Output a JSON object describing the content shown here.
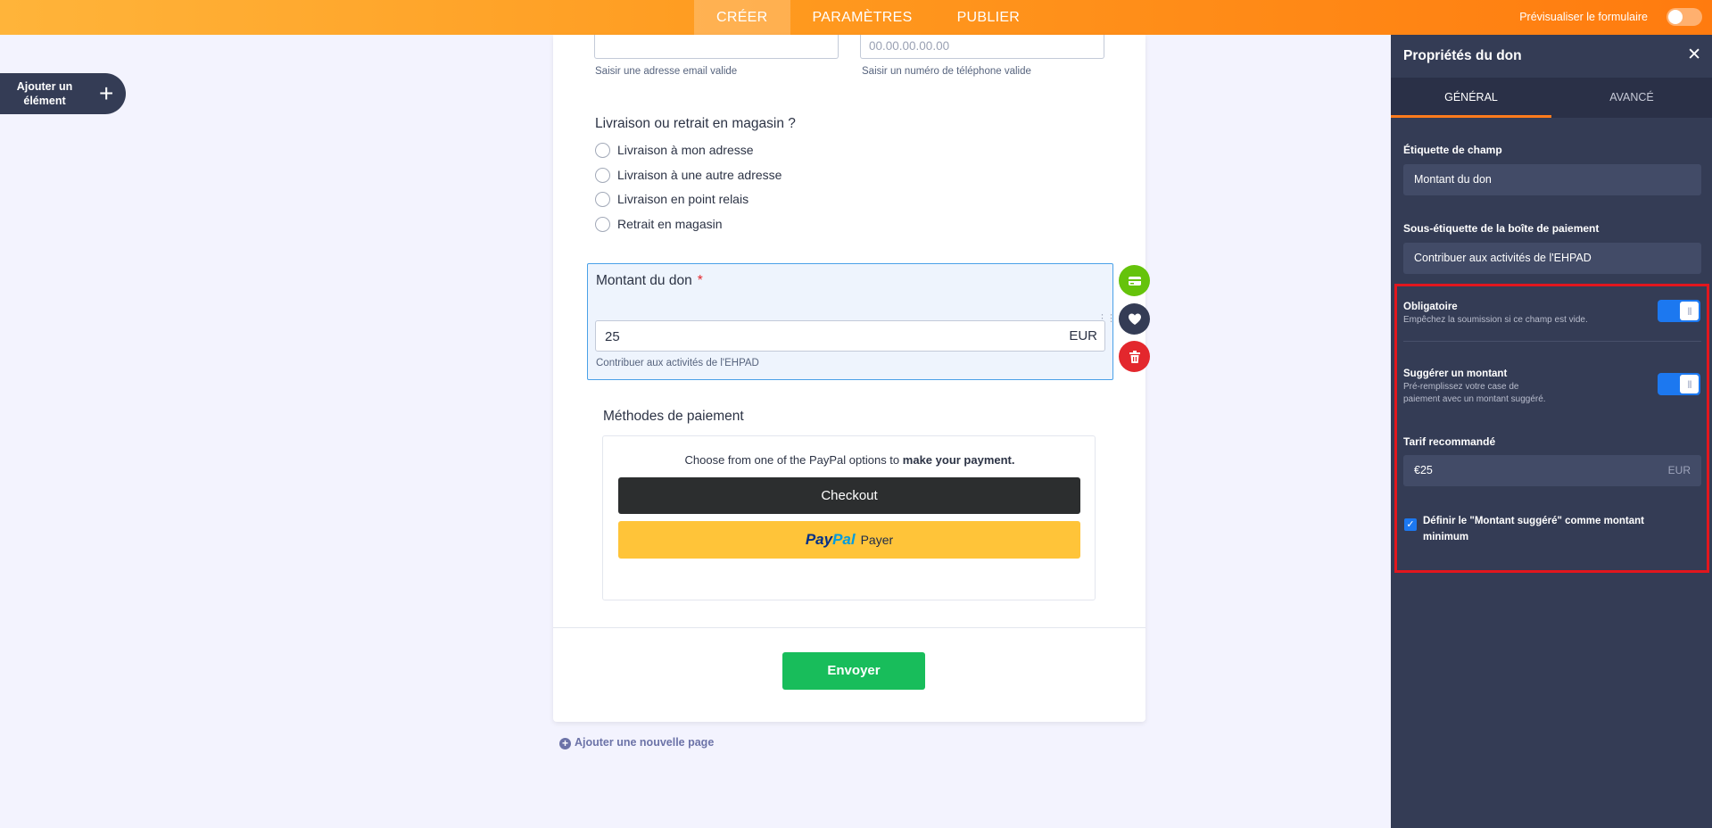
{
  "topbar": {
    "tabs": [
      "CRÉER",
      "PARAMÈTRES",
      "PUBLIER"
    ],
    "active_tab": "CRÉER",
    "preview_label": "Prévisualiser le formulaire",
    "preview_enabled": false
  },
  "sidebar": {
    "add_element_label": "Ajouter un élément",
    "add_icon": "plus-icon"
  },
  "form": {
    "email_sublabel": "Saisir une adresse email valide",
    "phone_placeholder": "00.00.00.00.00",
    "phone_sublabel": "Saisir un numéro de téléphone valide",
    "delivery_question": "Livraison ou retrait en magasin ?",
    "delivery_options": [
      "Livraison à mon adresse",
      "Livraison à une autre adresse",
      "Livraison en point relais",
      "Retrait en magasin"
    ],
    "donation": {
      "label": "Montant du don",
      "required_mark": "*",
      "value": "25",
      "currency": "EUR",
      "sublabel": "Contribuer aux activités de l'EHPAD"
    },
    "payment": {
      "title": "Méthodes de paiement",
      "intro_text": "Choose from one of the PayPal options to",
      "intro_bold": "make your payment.",
      "checkout_label": "Checkout",
      "paypal_brand_1": "Pay",
      "paypal_brand_2": "Pal",
      "paypal_action": "Payer"
    },
    "submit_label": "Envoyer",
    "add_page_label": "Ajouter une nouvelle page"
  },
  "field_actions": [
    "credit-card-icon",
    "heart-icon",
    "trash-icon"
  ],
  "panel": {
    "title": "Propriétés du don",
    "tabs": [
      "GÉNÉRAL",
      "AVANCÉ"
    ],
    "active_tab": "GÉNÉRAL",
    "field_label_title": "Étiquette de champ",
    "field_label_value": "Montant du don",
    "sublabel_title": "Sous-étiquette de la boîte de paiement",
    "sublabel_value": "Contribuer aux activités de l'EHPAD",
    "required_title": "Obligatoire",
    "required_desc": "Empêchez la soumission si ce champ est vide.",
    "required_on": true,
    "suggest_title": "Suggérer un montant",
    "suggest_desc": "Pré-remplissez votre case de paiement avec un montant suggéré.",
    "suggest_on": true,
    "rate_title": "Tarif recommandé",
    "rate_value": "€25",
    "rate_currency": "EUR",
    "min_checkbox_label": "Définir le \"Montant suggéré\" comme montant minimum",
    "min_checked": true
  },
  "colors": {
    "accent_orange": "#ff7b0f",
    "panel_bg": "#343c55",
    "toggle_blue": "#1c78f0",
    "highlight_red": "#e2161e",
    "submit_green": "#18bd5b",
    "paypal_yellow": "#ffc439"
  }
}
